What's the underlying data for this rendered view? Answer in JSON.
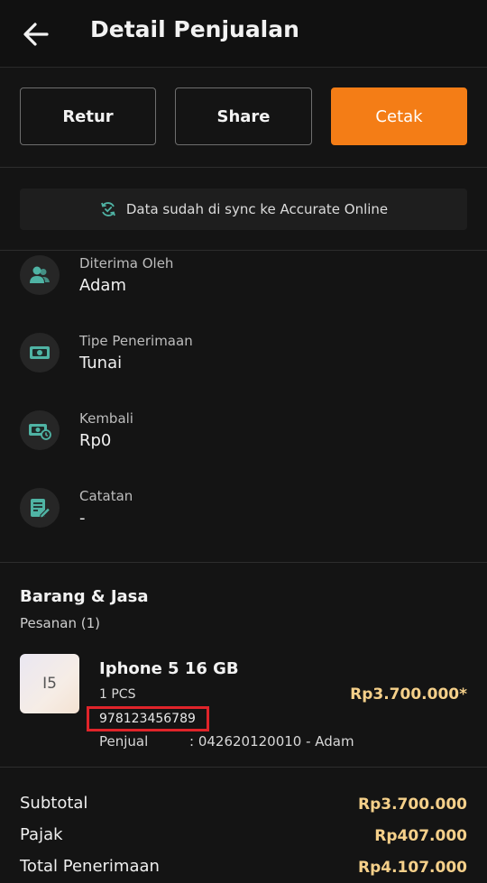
{
  "header": {
    "title": "Detail Penjualan"
  },
  "actions": {
    "retur": "Retur",
    "share": "Share",
    "cetak": "Cetak"
  },
  "sync": {
    "text": "Data sudah di sync ke Accurate Online"
  },
  "details": [
    {
      "label": "Diterima Oleh",
      "value": "Adam",
      "icon": "user-group-icon"
    },
    {
      "label": "Tipe Penerimaan",
      "value": "Tunai",
      "icon": "cash-icon"
    },
    {
      "label": "Kembali",
      "value": "Rp0",
      "icon": "change-cash-icon"
    },
    {
      "label": "Catatan",
      "value": "-",
      "icon": "note-edit-icon"
    }
  ],
  "goods": {
    "title": "Barang & Jasa",
    "orders": "Pesanan (1)"
  },
  "item": {
    "thumb_text": "I5",
    "name": "Iphone 5 16 GB",
    "qty": "1 PCS",
    "sku": "978123456789",
    "price": "Rp3.700.000*",
    "seller_label": "Penjual",
    "seller_value": ": 042620120010 - Adam"
  },
  "summary": {
    "subtotal_label": "Subtotal",
    "subtotal_value": "Rp3.700.000",
    "tax_label": "Pajak",
    "tax_value": "Rp407.000",
    "total_label": "Total Penerimaan",
    "total_value": "Rp4.107.000"
  },
  "colors": {
    "accent": "#f47d16",
    "price": "#f5d08a",
    "icon": "#4fb3a4",
    "highlight": "#e0242a"
  }
}
